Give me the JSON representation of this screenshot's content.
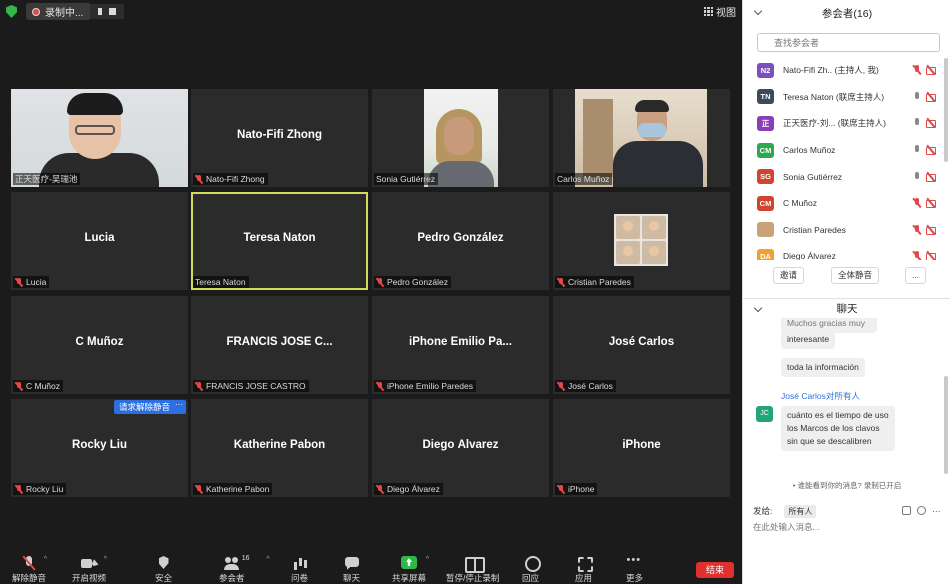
{
  "topbar": {
    "recording_label": "录制中...",
    "view_label": "视图"
  },
  "tiles": {
    "t1_label": "正天医疗-吴瑞池",
    "t2_big": "Nato-Fifi Zhong",
    "t2_label": "Nato-Fifi Zhong",
    "t3_label": "Sonia Gutiérrez",
    "t4_label": "Carlos Muñoz",
    "t5_big": "Lucia",
    "t5_label": "Lucia",
    "t6_big": "Teresa  Naton",
    "t6_label": "Teresa  Naton",
    "t7_big": "Pedro González",
    "t7_label": "Pedro González",
    "t8_label": "Cristian Paredes",
    "t9_big": "C Muñoz",
    "t9_label": "C Muñoz",
    "t10_big": "FRANCIS JOSE C...",
    "t10_label": "FRANCIS JOSE CASTRO",
    "t11_big": "iPhone Emilio Pa...",
    "t11_label": "iPhone Emilio Paredes",
    "t12_big": "José Carlos",
    "t12_label": "José Carlos",
    "t13_big": "Rocky Liu",
    "t13_label": "Rocky Liu",
    "t14_big": "Katherine Pabon",
    "t14_label": "Katherine Pabon",
    "t15_big": "Diego Álvarez",
    "t15_label": "Diego Álvarez",
    "t16_big": "iPhone",
    "t16_label": "iPhone",
    "raise_button": "请求解除静音",
    "raise_more": "···"
  },
  "toolbar": {
    "unmute": "解除静音",
    "start_video": "开启视频",
    "security": "安全",
    "participants": "参会者",
    "participants_count": "16",
    "qa": "问卷",
    "chat": "聊天",
    "share": "共享屏幕",
    "record": "暂停/停止录制",
    "reactions": "回应",
    "apps": "应用",
    "more": "更多",
    "end": "结束"
  },
  "panel": {
    "title": "参会者(16)",
    "search_placeholder": "查找参会者",
    "participants": [
      {
        "initials": "N2",
        "color": "#7c4fbf",
        "name": "Nato-Fifi Zh..  (主持人, 我)"
      },
      {
        "initials": "TN",
        "color": "#3c4a5c",
        "name": "Teresa  Naton (联席主持人)"
      },
      {
        "initials": "正",
        "color": "#8a3fb8",
        "name": "正天医疗-刘...  (联席主持人)"
      },
      {
        "initials": "CM",
        "color": "#2fa84f",
        "name": "Carlos Muñoz"
      },
      {
        "initials": "SG",
        "color": "#d0452f",
        "name": "Sonia Gutiérrez"
      },
      {
        "initials": "CM",
        "color": "#d0452f",
        "name": "C Muñoz"
      },
      {
        "initials": "",
        "color": "#c9a27a",
        "name": "Cristian Paredes"
      },
      {
        "initials": "DA",
        "color": "#f0a030",
        "name": "Diego Álvarez"
      }
    ],
    "invite": "邀请",
    "mute_all": "全体静音",
    "more": "...",
    "chat_title": "聊天",
    "chat_partial": "Muchos gracias muy",
    "chat_msg1": "interesante",
    "chat_msg2": "toda la información",
    "chat_sender": "José Carlos对所有人",
    "chat_avatar": "JC",
    "chat_msg3": "cuánto es el  tiempo de uso los Marcos de los clavos sin que se descalibren",
    "recording_note": "谁能看到你的消息? 录制已开启",
    "send_to_label": "发给:",
    "send_to_value": "所有人",
    "message_placeholder": "在此处输入消息..."
  }
}
